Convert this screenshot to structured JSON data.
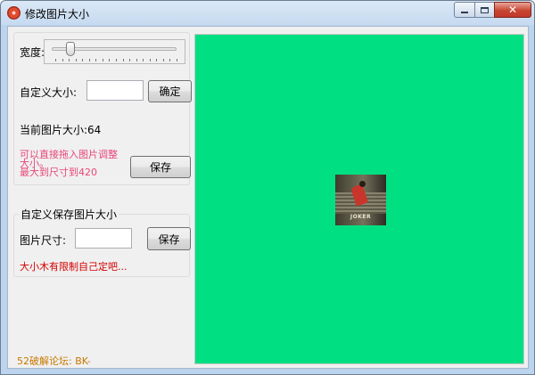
{
  "window": {
    "title": "修改图片大小",
    "close_glyph": "✕"
  },
  "width_slider": {
    "label": "宽度:",
    "value_fraction": 0.15
  },
  "custom_size": {
    "label": "自定义大小:",
    "value": "",
    "confirm_label": "确定"
  },
  "current_size": {
    "label": "当前图片大小:",
    "value": "64"
  },
  "hint": {
    "line1": "可以直接拖入图片调整大小。",
    "line2": "最大到尺寸到420"
  },
  "save_button": {
    "label": "保存"
  },
  "custom_save_group": {
    "title": "自定义保存图片大小",
    "size_label": "图片尺寸:",
    "size_value": "",
    "save_label": "保存",
    "note": "大小木有限制自己定吧..."
  },
  "footer": {
    "credit": "52破解论坛:  BK-"
  },
  "canvas": {
    "background_color": "#00df82",
    "poster_text": "JOKER"
  },
  "colors": {
    "hint_pink": "#e8477a",
    "note_red": "#d40000",
    "credit_orange": "#c87800"
  }
}
